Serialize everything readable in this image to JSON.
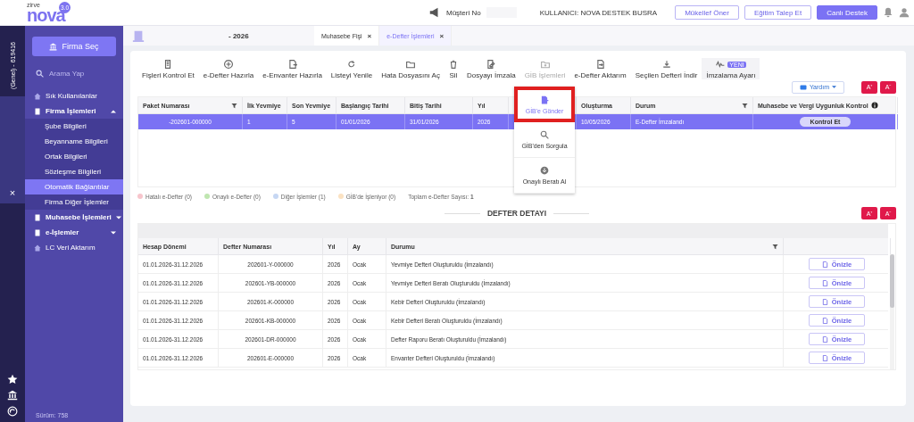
{
  "header": {
    "customer_label": "Müşteri No",
    "user": "KULLANICI: NOVA DESTEK BUSRA",
    "buttons": [
      {
        "label": "Mükellef Öner",
        "kind": "outline"
      },
      {
        "label": "Eğitim Talep Et",
        "kind": "outline"
      },
      {
        "label": "Canlı Destek",
        "kind": "filled"
      }
    ]
  },
  "logo": {
    "brand": "nova",
    "maker": "zirve",
    "version": "3.0"
  },
  "rail": {
    "company": "(Genel) - 619416",
    "close": "×"
  },
  "sidebar": {
    "firm_button": "Firma Seç",
    "search": {
      "placeholder": "Arama Yap"
    },
    "items": [
      {
        "label": "Sık Kullanılanlar",
        "kind": "link",
        "selected": false
      },
      {
        "label": "Firma İşlemleri",
        "kind": "group",
        "expanded": true,
        "selected": false,
        "children": [
          {
            "label": "Şube Bilgileri",
            "selected": false
          },
          {
            "label": "Beyanname Bilgileri",
            "selected": false
          },
          {
            "label": "Ortak Bilgileri",
            "selected": false
          },
          {
            "label": "Sözleşme Bilgileri",
            "selected": false
          },
          {
            "label": "Otomatik Bağlantılar",
            "selected": true
          },
          {
            "label": "Firma Diğer İşlemler",
            "selected": false
          }
        ]
      },
      {
        "label": "Muhasebe İşlemleri",
        "kind": "group",
        "expanded": false,
        "selected": false
      },
      {
        "label": "e-İşlemler",
        "kind": "group",
        "expanded": false,
        "selected": false
      },
      {
        "label": "LC Veri Aktarım",
        "kind": "link",
        "selected": false
      }
    ],
    "version": "Sürüm: 758"
  },
  "period": "- 2026",
  "tabs": [
    {
      "label": "Muhasebe Fişi",
      "selected": false,
      "close": "×"
    },
    {
      "label": "e-Defter İşlemleri",
      "selected": true,
      "close": "×"
    }
  ],
  "toolbar": [
    {
      "label": "Fişleri Kontrol Et",
      "open": false
    },
    {
      "label": "e-Defter Hazırla",
      "open": false
    },
    {
      "label": "e-Envanter Hazırla",
      "open": false
    },
    {
      "label": "Listeyi Yenile",
      "open": false
    },
    {
      "label": "Hata Dosyasını Aç",
      "open": false
    },
    {
      "label": "Sil",
      "open": false
    },
    {
      "label": "Dosyayı İmzala",
      "open": false
    },
    {
      "label": "GİB İşlemleri",
      "open": true
    },
    {
      "label": "e-Defter Aktarım",
      "open": false
    },
    {
      "label": "Seçilen Defteri İndir",
      "open": false
    },
    {
      "label": "İmzalama Ayarı",
      "open": false,
      "badge": "YENİ"
    }
  ],
  "gib_menu": [
    {
      "label": "GİB'e Gönder",
      "selected": true
    },
    {
      "label": "GİB'den Sorgula",
      "selected": false
    },
    {
      "label": "Onaylı Beratı Al",
      "selected": false
    }
  ],
  "help_button": "Yardım",
  "font_buttons": [
    "A⁺",
    "A⁻"
  ],
  "packages": {
    "columns": [
      {
        "label": "Paket Numarası",
        "filter": true
      },
      {
        "label": "İlk Yevmiye"
      },
      {
        "label": "Son Yevmiye"
      },
      {
        "label": "Başlangıç Tarihi"
      },
      {
        "label": "Bitiş Tarihi"
      },
      {
        "label": "Yıl"
      },
      {
        "label": "Oluşturma"
      },
      {
        "label": "Durum",
        "filter": true
      },
      {
        "label": "Muhasebe ve Vergi Uygunluk Kontrol",
        "info": true
      }
    ],
    "rows": [
      {
        "selected": true,
        "cells": [
          "-202601-000000",
          "1",
          "5",
          "01/01/2026",
          "31/01/2026",
          "2026",
          "10/05/2026",
          "E-Defter İmzalandı"
        ],
        "action": "Kontrol Et"
      }
    ]
  },
  "legend": [
    {
      "label": "Hatalı e-Defter (0)",
      "color": "#f7c5cc"
    },
    {
      "label": "Onaylı e-Defter (0)",
      "color": "#bfe6b0"
    },
    {
      "label": "Diğer İşlemler (1)",
      "color": "#c6d7f3"
    },
    {
      "label": "GİB'de İşleniyor (0)",
      "color": "#fbe2c2"
    }
  ],
  "total": "Toplam e-Defter Sayısı: **1**",
  "detail": {
    "title": "DEFTER DETAYI",
    "font_buttons": [
      "A⁺",
      "A⁻"
    ],
    "columns": [
      {
        "label": "Hesap Dönemi"
      },
      {
        "label": "Defter Numarası"
      },
      {
        "label": "Yıl"
      },
      {
        "label": "Ay"
      },
      {
        "label": "Durumu",
        "filter": true
      }
    ],
    "rows": [
      {
        "cells": [
          "01.01.2026-31.12.2026",
          "202601-Y-000000",
          "2026",
          "Ocak",
          "Yevmiye Defteri Oluşturuldu (İmzalandı)"
        ],
        "preview": "Önizle"
      },
      {
        "cells": [
          "01.01.2026-31.12.2026",
          "202601-YB-000000",
          "2026",
          "Ocak",
          "Yevmiye Defteri Beratı Oluşturuldu (İmzalandı)"
        ],
        "preview": "Önizle"
      },
      {
        "cells": [
          "01.01.2026-31.12.2026",
          "202601-K-000000",
          "2026",
          "Ocak",
          "Kebir Defteri Oluşturuldu (İmzalandı)"
        ],
        "preview": "Önizle"
      },
      {
        "cells": [
          "01.01.2026-31.12.2026",
          "202601-KB-000000",
          "2026",
          "Ocak",
          "Kebir Defteri Beratı Oluşturuldu (İmzalandı)"
        ],
        "preview": "Önizle"
      },
      {
        "cells": [
          "01.01.2026-31.12.2026",
          "202601-DR-000000",
          "2026",
          "Ocak",
          "Defter Raporu Beratı Oluşturuldu (İmzalandı)"
        ],
        "preview": "Önizle"
      },
      {
        "cells": [
          "01.01.2026-31.12.2026",
          "202601-E-000000",
          "2026",
          "Ocak",
          "Envanter Defteri Oluşturuldu (İmzalandı)"
        ],
        "preview": "Önizle"
      }
    ]
  }
}
